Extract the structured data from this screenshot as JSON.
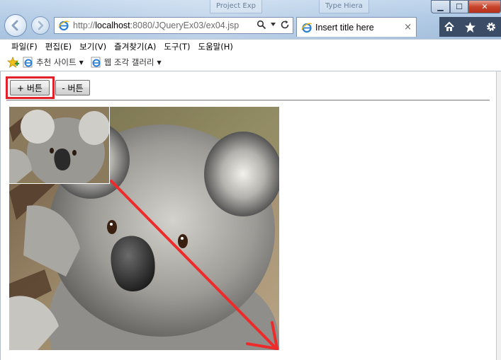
{
  "window": {
    "ghost_tabs": [
      "Project Exp",
      "Type Hiera"
    ],
    "controls": {
      "minimize": "▁",
      "maximize": "☐",
      "close": "✕"
    }
  },
  "addressbar": {
    "url_scheme": "http://",
    "url_host": "localhost",
    "url_rest": ":8080/JQueryEx03/ex04.jsp",
    "search_icon": "search-icon",
    "refresh_icon": "refresh-icon"
  },
  "tab": {
    "title": "Insert title here",
    "close": "×"
  },
  "toolbar_icons": [
    "home-icon",
    "favorites-star-icon",
    "tools-gear-icon"
  ],
  "menubar": {
    "items": [
      "파일(F)",
      "편집(E)",
      "보기(V)",
      "즐겨찾기(A)",
      "도구(T)",
      "도움말(H)"
    ]
  },
  "favorites": {
    "items": [
      {
        "label": "추천 사이트",
        "icon": "ie-page-icon",
        "dropdown": true
      },
      {
        "label": "웹 조각 갤러리",
        "icon": "ie-page-icon",
        "dropdown": true
      }
    ]
  },
  "page": {
    "plus_button": "+ 버튼",
    "minus_button": "- 버튼",
    "highlight_color": "#e3212b",
    "image_subject": "koala"
  }
}
